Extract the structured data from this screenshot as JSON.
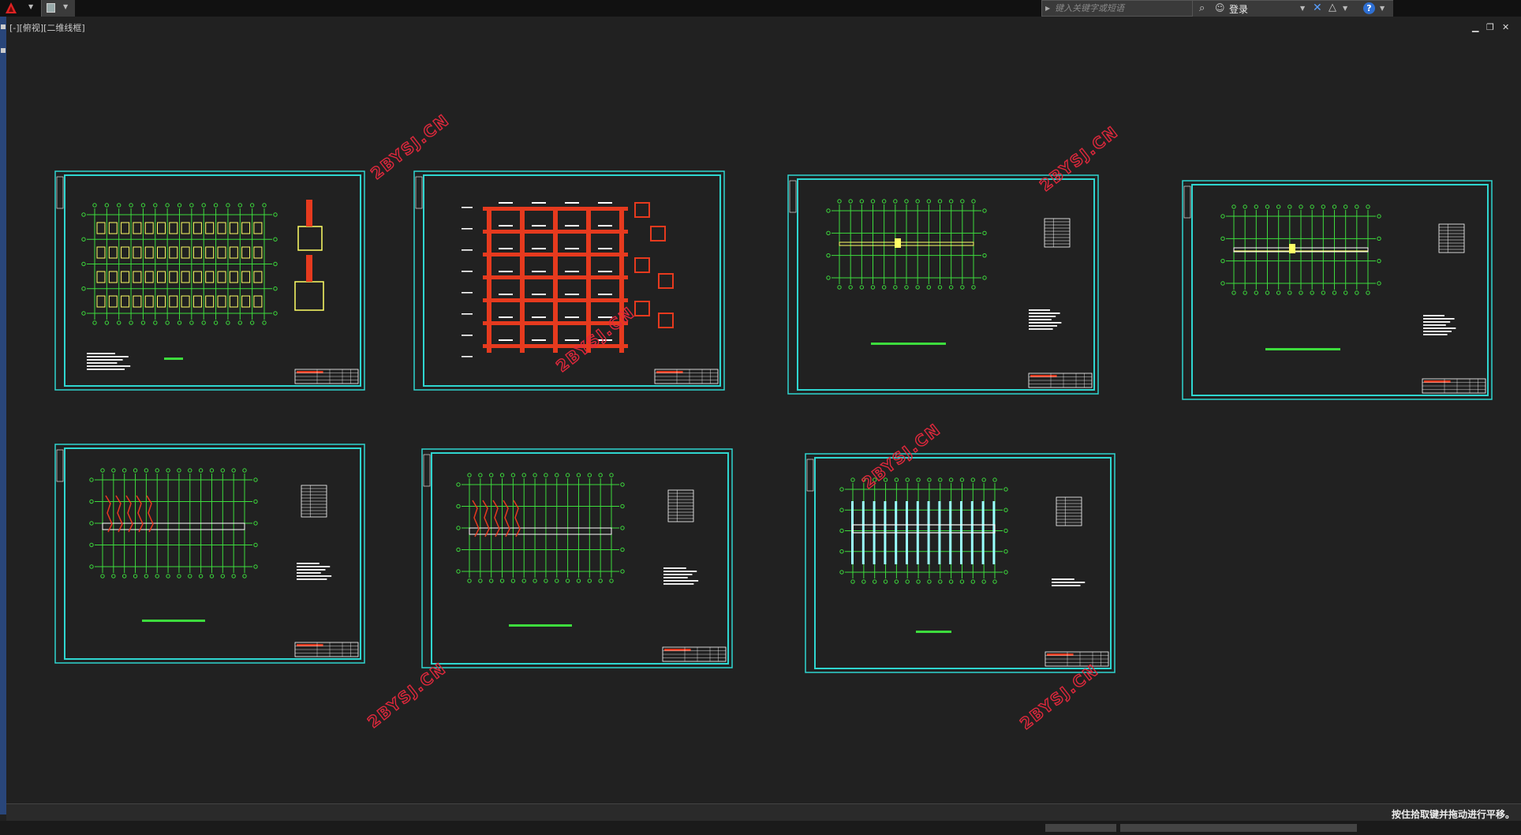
{
  "search": {
    "placeholder": "键入关键字或短语"
  },
  "user": {
    "login_label": "登录"
  },
  "viewport": {
    "label": "[-][俯视][二维线框]"
  },
  "status": {
    "message": "按住拾取键并拖动进行平移。"
  },
  "watermark": {
    "text": "2BYSJ.CN"
  },
  "icons": {
    "app": "autocad-app-icon",
    "save": "save-icon",
    "binoculars": "binoculars-icon",
    "user": "user-icon",
    "exchange": "exchange-x-icon",
    "a360": "a360-icon",
    "help": "help-icon",
    "minimize": "minimize-icon",
    "restore": "restore-icon",
    "close": "close-icon"
  },
  "colors": {
    "background": "#212121",
    "frame": "#2fd6d0",
    "grid": "#3ddc3d",
    "column": "#ffff66",
    "beam": "#e63a1e",
    "watermark": "#e0283c",
    "accent": "#2e6fd3"
  }
}
